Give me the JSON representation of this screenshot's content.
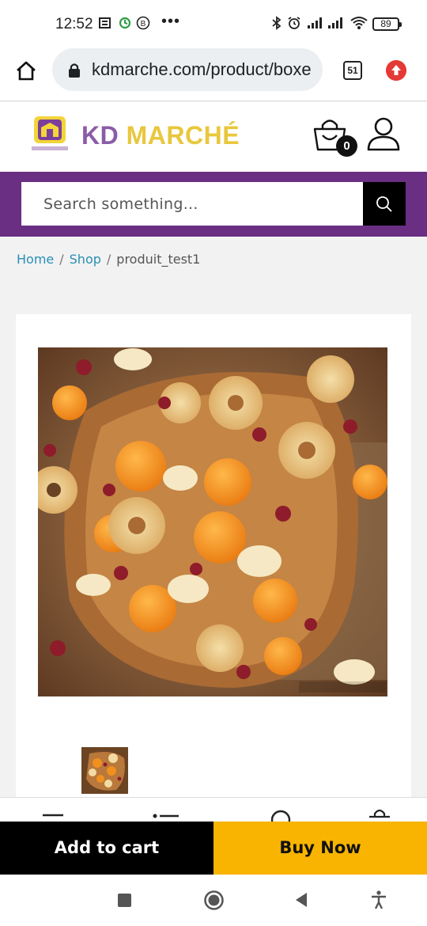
{
  "status_bar": {
    "time": "12:52",
    "battery": "89",
    "icons": [
      "notes-icon",
      "sync-icon",
      "b-icon",
      "more-dots-icon",
      "bluetooth-icon",
      "alarm-icon",
      "signal-icon",
      "signal-icon",
      "wifi-icon",
      "battery-icon"
    ]
  },
  "browser": {
    "url": "kdmarche.com/product/boxe",
    "tab_count": "51"
  },
  "site": {
    "logo_kd": "KD",
    "logo_marche": "MARCHÉ",
    "cart_count": "0",
    "brand_color": "#6a2f82",
    "accent_color": "#f8b400"
  },
  "search": {
    "placeholder": "Search something..."
  },
  "breadcrumb": {
    "home": "Home",
    "shop": "Shop",
    "separator": "/",
    "current": "produit_test1"
  },
  "actions": {
    "add_to_cart": "Add to cart",
    "buy_now": "Buy Now"
  }
}
